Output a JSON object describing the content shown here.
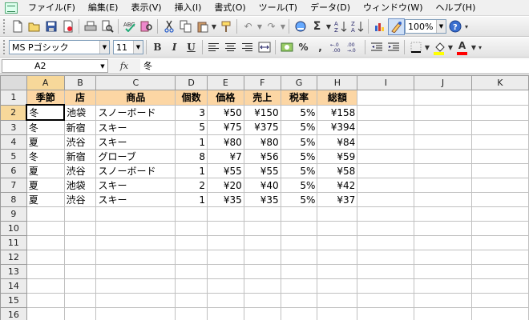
{
  "menu": [
    "ファイル(F)",
    "編集(E)",
    "表示(V)",
    "挿入(I)",
    "書式(O)",
    "ツール(T)",
    "データ(D)",
    "ウィンドウ(W)",
    "ヘルプ(H)"
  ],
  "toolbar": {
    "zoom": "100%",
    "font_name": "MS Pゴシック",
    "font_size": "11",
    "bold": "B",
    "italic": "I",
    "underline": "U",
    "sigma": "Σ",
    "percent": "%",
    "comma": ",",
    "font_color_letter": "A",
    "fill_color": "#ffff00",
    "font_color": "#ff0000"
  },
  "formula_bar": {
    "name_box": "A2",
    "fx_label": "fx",
    "value": "冬"
  },
  "grid": {
    "columns": [
      "A",
      "B",
      "C",
      "D",
      "E",
      "F",
      "G",
      "H",
      "I",
      "J",
      "K"
    ],
    "active_column": "A",
    "active_row": 2,
    "header_fill": "#fcd6a4",
    "rows": [
      {
        "num": "1",
        "cells": [
          "季節",
          "店",
          "商品",
          "個数",
          "価格",
          "売上",
          "税率",
          "総額",
          "",
          "",
          ""
        ]
      },
      {
        "num": "2",
        "cells": [
          "冬",
          "池袋",
          "スノーボード",
          "3",
          "¥50",
          "¥150",
          "5%",
          "¥158",
          "",
          "",
          ""
        ]
      },
      {
        "num": "3",
        "cells": [
          "冬",
          "新宿",
          "スキー",
          "5",
          "¥75",
          "¥375",
          "5%",
          "¥394",
          "",
          "",
          ""
        ]
      },
      {
        "num": "4",
        "cells": [
          "夏",
          "渋谷",
          "スキー",
          "1",
          "¥80",
          "¥80",
          "5%",
          "¥84",
          "",
          "",
          ""
        ]
      },
      {
        "num": "5",
        "cells": [
          "冬",
          "新宿",
          "グローブ",
          "8",
          "¥7",
          "¥56",
          "5%",
          "¥59",
          "",
          "",
          ""
        ]
      },
      {
        "num": "6",
        "cells": [
          "夏",
          "渋谷",
          "スノーボード",
          "1",
          "¥55",
          "¥55",
          "5%",
          "¥58",
          "",
          "",
          ""
        ]
      },
      {
        "num": "7",
        "cells": [
          "夏",
          "池袋",
          "スキー",
          "2",
          "¥20",
          "¥40",
          "5%",
          "¥42",
          "",
          "",
          ""
        ]
      },
      {
        "num": "8",
        "cells": [
          "夏",
          "渋谷",
          "スキー",
          "1",
          "¥35",
          "¥35",
          "5%",
          "¥37",
          "",
          "",
          ""
        ]
      },
      {
        "num": "9",
        "cells": [
          "",
          "",
          "",
          "",
          "",
          "",
          "",
          "",
          "",
          "",
          ""
        ]
      },
      {
        "num": "10",
        "cells": [
          "",
          "",
          "",
          "",
          "",
          "",
          "",
          "",
          "",
          "",
          ""
        ]
      },
      {
        "num": "11",
        "cells": [
          "",
          "",
          "",
          "",
          "",
          "",
          "",
          "",
          "",
          "",
          ""
        ]
      },
      {
        "num": "12",
        "cells": [
          "",
          "",
          "",
          "",
          "",
          "",
          "",
          "",
          "",
          "",
          ""
        ]
      },
      {
        "num": "13",
        "cells": [
          "",
          "",
          "",
          "",
          "",
          "",
          "",
          "",
          "",
          "",
          ""
        ]
      },
      {
        "num": "14",
        "cells": [
          "",
          "",
          "",
          "",
          "",
          "",
          "",
          "",
          "",
          "",
          ""
        ]
      },
      {
        "num": "15",
        "cells": [
          "",
          "",
          "",
          "",
          "",
          "",
          "",
          "",
          "",
          "",
          ""
        ]
      },
      {
        "num": "16",
        "cells": [
          "",
          "",
          "",
          "",
          "",
          "",
          "",
          "",
          "",
          "",
          ""
        ]
      }
    ]
  }
}
